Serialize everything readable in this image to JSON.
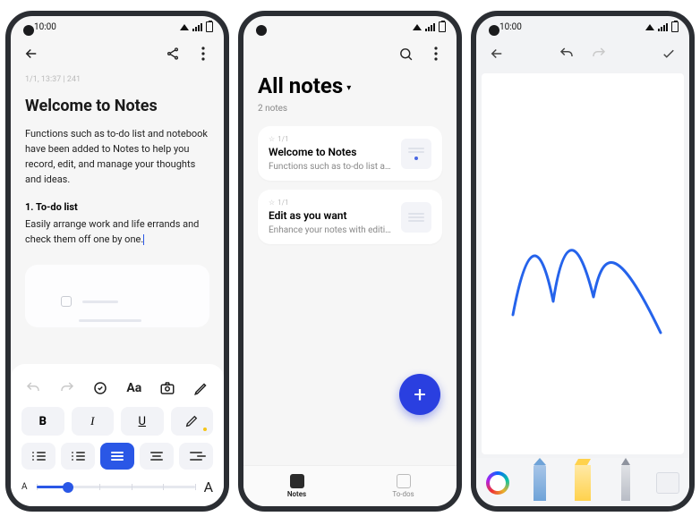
{
  "status": {
    "time": "10:00"
  },
  "phone1": {
    "meta": "1/1, 13:37  |  241",
    "title": "Welcome to Notes",
    "intro": "Functions such as to-do list and notebook have been added to Notes to help you record, edit, and manage your thoughts and ideas.",
    "section_heading": "1. To-do list",
    "section_body": "Easily arrange work and life errands and check them off one by one.",
    "fmt": {
      "aa": "Aa",
      "b": "B",
      "i": "I",
      "u": "U"
    },
    "size": {
      "small": "A",
      "big": "A"
    }
  },
  "phone2": {
    "heading": "All notes",
    "count": "2 notes",
    "cards": [
      {
        "meta": "1/1",
        "title": "Welcome to Notes",
        "desc": "Functions such as to-do list an…"
      },
      {
        "meta": "1/1",
        "title": "Edit as you want",
        "desc": "Enhance your notes with editin…"
      }
    ],
    "tabs": {
      "notes": "Notes",
      "todos": "To-dos"
    }
  }
}
